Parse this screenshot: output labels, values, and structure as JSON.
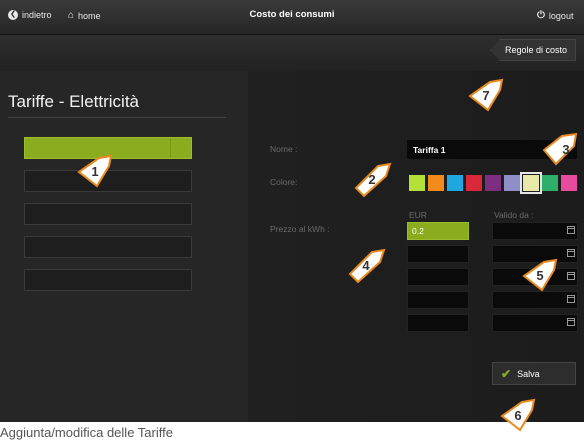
{
  "topbar": {
    "back_label": "indietro",
    "home_label": "home",
    "title": "Costo dei consumi",
    "logout_label": "logout"
  },
  "rules_button": "Regole di costo",
  "panel_title": "Tariffe - Elettricità",
  "tariff_list": [
    "",
    "",
    "",
    "",
    ""
  ],
  "form": {
    "name_label": "Nome :",
    "name_value": "Tariffa 1",
    "color_label": "Colore:",
    "price_label": "Prezzo al kWh :",
    "eur_header": "EUR",
    "valid_header": "Valido da :",
    "eur_values": [
      "0.2",
      "",
      "",
      "",
      ""
    ],
    "date_values": [
      "",
      "",
      "",
      "",
      ""
    ]
  },
  "colors": [
    "#b5e03a",
    "#f28a1c",
    "#1fa8e0",
    "#d8283a",
    "#7e2e80",
    "#8e8ec8",
    "#e8e8a8",
    "#2fb06a",
    "#e84a9e"
  ],
  "selected_color_index": 6,
  "save_label": "Salva",
  "callouts": [
    "1",
    "2",
    "3",
    "4",
    "5",
    "6",
    "7"
  ],
  "caption": "Aggiunta/modifica delle Tariffe"
}
